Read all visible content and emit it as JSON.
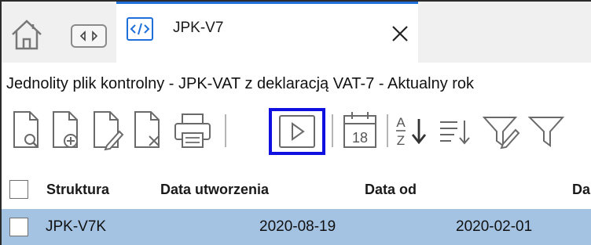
{
  "tabs": [
    {
      "label": "JPK-V7",
      "active": true
    }
  ],
  "subtitle": "Jednolity plik kontrolny - JPK-VAT z deklaracją VAT-7 - Aktualny rok",
  "toolbar": {
    "buttons": [
      {
        "name": "preview-document-icon"
      },
      {
        "name": "add-document-icon"
      },
      {
        "name": "edit-document-icon"
      },
      {
        "name": "delete-document-icon"
      },
      {
        "name": "print-icon"
      },
      {
        "name": "run-play-icon",
        "highlighted": true
      },
      {
        "name": "calendar-icon",
        "label": "18"
      },
      {
        "name": "sort-az-icon",
        "label_top": "A",
        "label_bottom": "Z"
      },
      {
        "name": "sort-lines-icon"
      },
      {
        "name": "filter-edit-icon"
      },
      {
        "name": "filter-icon"
      }
    ],
    "highlight_color": "#1010e0"
  },
  "grid": {
    "columns": [
      "Struktura",
      "Data utworzenia",
      "Data od",
      "Da"
    ],
    "rows": [
      {
        "struktura": "JPK-V7K",
        "data_utworzenia": "2020-08-19",
        "data_od": "2020-02-01",
        "selected": true
      }
    ],
    "selected_row_color": "#a4c2e2"
  },
  "colors": {
    "tab_accent": "#1e6fd9",
    "tabbar_bg": "#f0f0f0"
  }
}
